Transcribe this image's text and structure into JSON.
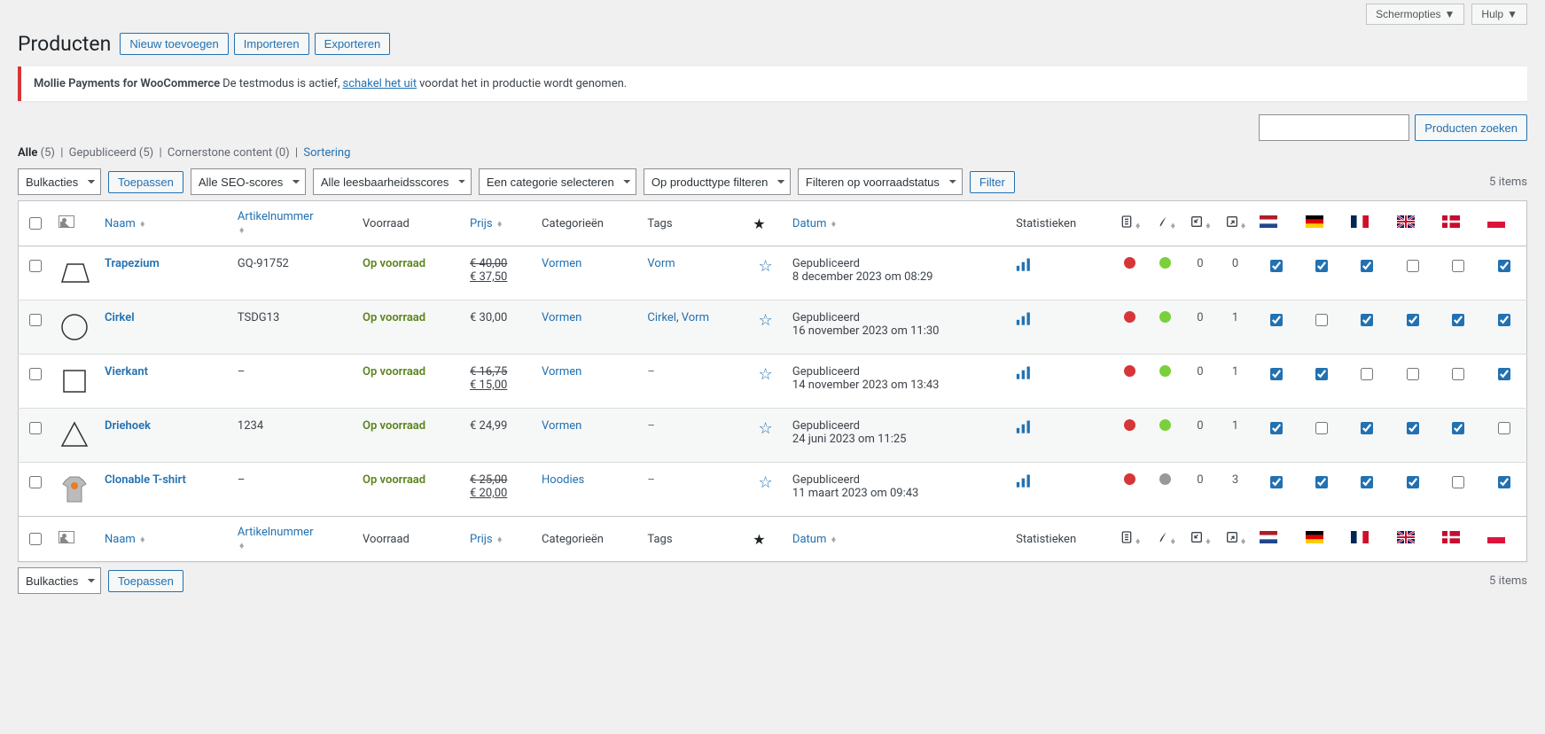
{
  "topbar": {
    "screen_options": "Schermopties",
    "help": "Hulp"
  },
  "title": "Producten",
  "actions": {
    "add_new": "Nieuw toevoegen",
    "import": "Importeren",
    "export": "Exporteren"
  },
  "notice": {
    "bold": "Mollie Payments for WooCommerce",
    "text1": " De testmodus is actief, ",
    "link": "schakel het uit",
    "text2": " voordat het in productie wordt genomen."
  },
  "views": {
    "all_label": "Alle",
    "all_count": "(5)",
    "published_label": "Gepubliceerd",
    "published_count": "(5)",
    "cornerstone_label": "Cornerstone content",
    "cornerstone_count": "(0)",
    "sorting": "Sortering"
  },
  "search": {
    "button": "Producten zoeken"
  },
  "bulk": {
    "label": "Bulkacties",
    "apply": "Toepassen"
  },
  "filters": {
    "seo": "Alle SEO-scores",
    "readability": "Alle leesbaarheidsscores",
    "category": "Een categorie selecteren",
    "ptype": "Op producttype filteren",
    "stock": "Filteren op voorraadstatus",
    "filter_btn": "Filter"
  },
  "count_text": "5 items",
  "columns": {
    "name": "Naam",
    "sku": "Artikelnummer",
    "stock": "Voorraad",
    "price": "Prijs",
    "categories": "Categorieën",
    "tags": "Tags",
    "date": "Datum",
    "stats": "Statistieken"
  },
  "rows": [
    {
      "name": "Trapezium",
      "sku": "GQ-91752",
      "stock": "Op voorraad",
      "price_old": "€ 40,00",
      "price_new": "€ 37,50",
      "price_single": "",
      "cats": "Vormen",
      "tags": [
        "Vorm"
      ],
      "date_status": "Gepubliceerd",
      "date_text": "8 december 2023 om 08:29",
      "seo": "red",
      "read": "green",
      "links_in": "0",
      "links_out": "0",
      "flags": [
        true,
        true,
        true,
        false,
        false,
        true
      ],
      "shape": "trap"
    },
    {
      "name": "Cirkel",
      "sku": "TSDG13",
      "stock": "Op voorraad",
      "price_old": "",
      "price_new": "",
      "price_single": "€ 30,00",
      "cats": "Vormen",
      "tags": [
        "Cirkel",
        "Vorm"
      ],
      "date_status": "Gepubliceerd",
      "date_text": "16 november 2023 om 11:30",
      "seo": "red",
      "read": "green",
      "links_in": "0",
      "links_out": "1",
      "flags": [
        true,
        false,
        true,
        true,
        true,
        true
      ],
      "shape": "circle"
    },
    {
      "name": "Vierkant",
      "sku": "–",
      "stock": "Op voorraad",
      "price_old": "€ 16,75",
      "price_new": "€ 15,00",
      "price_single": "",
      "cats": "Vormen",
      "tags": [],
      "date_status": "Gepubliceerd",
      "date_text": "14 november 2023 om 13:43",
      "seo": "red",
      "read": "green",
      "links_in": "0",
      "links_out": "1",
      "flags": [
        true,
        true,
        false,
        false,
        false,
        true
      ],
      "shape": "square"
    },
    {
      "name": "Driehoek",
      "sku": "1234",
      "stock": "Op voorraad",
      "price_old": "",
      "price_new": "",
      "price_single": "€ 24,99",
      "cats": "Vormen",
      "tags": [],
      "date_status": "Gepubliceerd",
      "date_text": "24 juni 2023 om 11:25",
      "seo": "red",
      "read": "green",
      "links_in": "0",
      "links_out": "1",
      "flags": [
        true,
        false,
        true,
        true,
        true,
        false
      ],
      "shape": "triangle"
    },
    {
      "name": "Clonable T-shirt",
      "sku": "–",
      "stock": "Op voorraad",
      "price_old": "€ 25,00",
      "price_new": "€ 20,00",
      "price_single": "",
      "cats": "Hoodies",
      "tags": [],
      "date_status": "Gepubliceerd",
      "date_text": "11 maart 2023 om 09:43",
      "seo": "red",
      "read": "grey",
      "links_in": "0",
      "links_out": "3",
      "flags": [
        true,
        true,
        true,
        true,
        false,
        true
      ],
      "shape": "tshirt"
    }
  ]
}
